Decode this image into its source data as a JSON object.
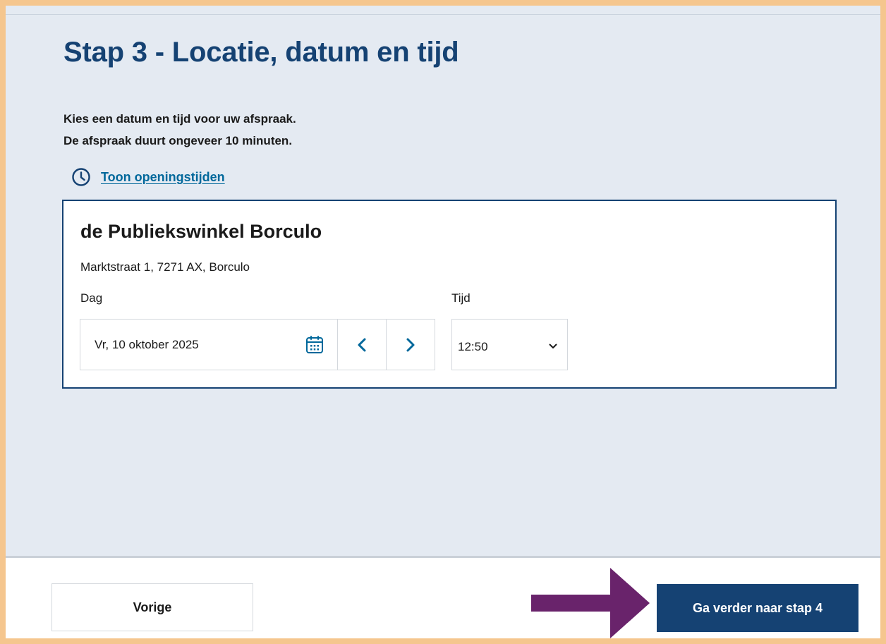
{
  "colors": {
    "frame": "#F5C68E",
    "page_background": "#E4EAF2",
    "heading": "#154273",
    "link": "#01689B",
    "primary_button": "#154273",
    "annotation_arrow": "#69236B"
  },
  "page": {
    "title": "Stap 3 - Locatie, datum en tijd",
    "intro_line_1": "Kies een datum en tijd voor uw afspraak.",
    "intro_line_2": "De afspraak duurt ongeveer 10 minuten.",
    "opening_hours_link": "Toon openingstijden",
    "opening_hours_icon": "clock-icon"
  },
  "location": {
    "name": "de Publiekswinkel Borculo",
    "address": "Marktstraat 1, 7271 AX, Borculo",
    "day_label": "Dag",
    "day_value": "Vr, 10 oktober 2025",
    "calendar_icon": "calendar-icon",
    "prev_icon": "chevron-left-icon",
    "next_icon": "chevron-right-icon",
    "time_label": "Tijd",
    "time_value": "12:50",
    "time_dropdown_icon": "chevron-down-icon"
  },
  "footer": {
    "previous_label": "Vorige",
    "next_label": "Ga verder naar stap 4",
    "annotation": "arrow-right-icon"
  }
}
